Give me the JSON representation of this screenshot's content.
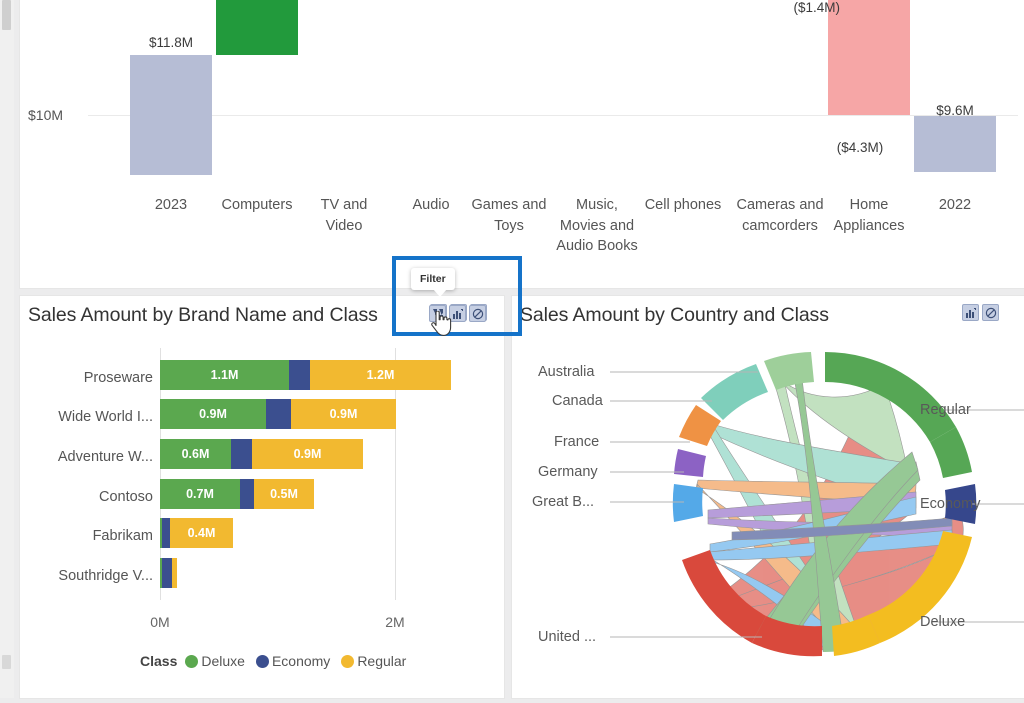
{
  "app": {
    "background_color": "#ececed",
    "accent_color": "#1573c9"
  },
  "scrollbar": {
    "name": "vertical-scrollbar"
  },
  "tooltip": {
    "label": "Filter"
  },
  "visuals": {
    "waterfall": {
      "title": "",
      "chart_data": {
        "type": "bar",
        "subtype": "waterfall",
        "title": "",
        "xlabel": "",
        "ylabel": "",
        "categories": [
          "2023",
          "Computers",
          "TV and Video",
          "Audio",
          "Games and Toys",
          "Music, Movies and Audio Books",
          "Cell phones",
          "Cameras and camcorders",
          "Home Appliances",
          "2022"
        ],
        "bar_types": [
          "total",
          "increase",
          "neutral",
          "neutral",
          "neutral",
          "neutral",
          "neutral",
          "decrease",
          "decrease",
          "total"
        ],
        "data_labels": [
          "$11.8M",
          "",
          "",
          "",
          "",
          "",
          "",
          "($1.4M)",
          "($4.3M)",
          "$9.6M"
        ],
        "values": [
          11.8,
          1.5,
          0,
          0,
          0,
          0,
          0,
          -1.4,
          -4.3,
          9.6
        ],
        "ytick_labels": [
          "$10M"
        ],
        "yticks": [
          10
        ],
        "colors": {
          "total": "#b6bdd5",
          "increase": "#229a3c",
          "decrease": "#f6a6a6"
        },
        "grid": true
      }
    },
    "bar": {
      "title": "Sales Amount by Brand Name and Class",
      "header_icons": [
        "filter-drill-icon",
        "focus-mode-icon",
        "clear-filter-icon"
      ],
      "chart_data": {
        "type": "bar",
        "subtype": "stacked-horizontal-bar",
        "title": "Sales Amount by Brand Name and Class",
        "xlabel": "",
        "ylabel": "",
        "categories": [
          "Proseware",
          "Wide World I...",
          "Adventure W...",
          "Contoso",
          "Fabrikam",
          "Southridge V..."
        ],
        "series": [
          {
            "name": "Deluxe",
            "color": "#5ba84f",
            "values": [
              1.1,
              0.9,
              0.6,
              0.7,
              0.02,
              0.01
            ],
            "labels": [
              "1.1M",
              "0.9M",
              "0.6M",
              "0.7M",
              "",
              ""
            ]
          },
          {
            "name": "Economy",
            "color": "#3b4f8f",
            "values": [
              0.18,
              0.22,
              0.17,
              0.12,
              0.05,
              0.06
            ],
            "labels": [
              "",
              "",
              "",
              "",
              "",
              ""
            ]
          },
          {
            "name": "Regular",
            "color": "#f2b930",
            "values": [
              1.2,
              0.9,
              0.9,
              0.5,
              0.4,
              0.02
            ],
            "labels": [
              "1.2M",
              "0.9M",
              "0.9M",
              "0.5M",
              "0.4M",
              ""
            ]
          }
        ],
        "xtick_labels": [
          "0M",
          "2M"
        ],
        "xticks": [
          0,
          2
        ],
        "xlim": [
          0,
          2.35
        ],
        "legend": {
          "title": "Class",
          "position": "bottom",
          "entries": [
            {
              "label": "Deluxe",
              "color": "#5ba84f"
            },
            {
              "label": "Economy",
              "color": "#3b4f8f"
            },
            {
              "label": "Regular",
              "color": "#f2b930"
            }
          ]
        },
        "grid": false
      }
    },
    "chord": {
      "title": "Sales Amount by Country and Class",
      "header_icons": [
        "focus-mode-icon",
        "clear-filter-icon"
      ],
      "chart_data": {
        "type": "chord",
        "title": "Sales Amount by Country and Class",
        "source_nodes": [
          {
            "label": "Australia",
            "color": "#9ecf9a"
          },
          {
            "label": "Canada",
            "color": "#7fcfbb"
          },
          {
            "label": "France",
            "color": "#ef9244"
          },
          {
            "label": "Germany",
            "color": "#8c62c4"
          },
          {
            "label": "Great B...",
            "color": "#54a9e8"
          },
          {
            "label": "United ...",
            "color": "#d9493c"
          }
        ],
        "target_nodes": [
          {
            "label": "Regular",
            "color": "#56a755"
          },
          {
            "label": "Economy",
            "color": "#36478c"
          },
          {
            "label": "Deluxe",
            "color": "#f3bd20"
          }
        ]
      }
    }
  }
}
